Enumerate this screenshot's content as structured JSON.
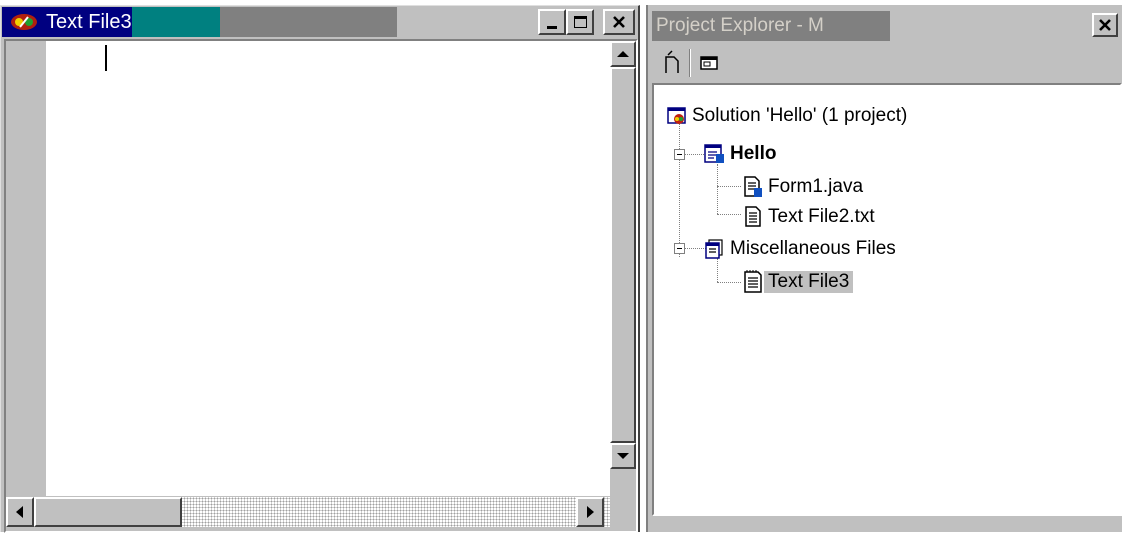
{
  "editor": {
    "title": "Text File3",
    "content": "",
    "caption_buttons": [
      "minimize",
      "maximize",
      "close"
    ]
  },
  "explorer": {
    "title": "Project Explorer - M",
    "toolbar": [
      "properties-icon",
      "view-code-icon"
    ],
    "tree": [
      {
        "label": "Solution 'Hello' (1 project)",
        "icon": "solution-icon",
        "level": 0
      },
      {
        "label": "Hello",
        "icon": "java-project-icon",
        "level": 1,
        "bold": true,
        "expanded": true
      },
      {
        "label": "Form1.java",
        "icon": "java-file-icon",
        "level": 2
      },
      {
        "label": "Text File2.txt",
        "icon": "text-file-icon",
        "level": 2
      },
      {
        "label": "Miscellaneous Files",
        "icon": "misc-files-icon",
        "level": 1,
        "expanded": true
      },
      {
        "label": "Text File3",
        "icon": "text-file-icon",
        "level": 2,
        "selected": true
      }
    ]
  },
  "colors": {
    "titlebar_active": "#000080",
    "titlebar_gradient": "#008080",
    "titlebar_inactive": "#808080",
    "face": "#c0c0c0"
  }
}
